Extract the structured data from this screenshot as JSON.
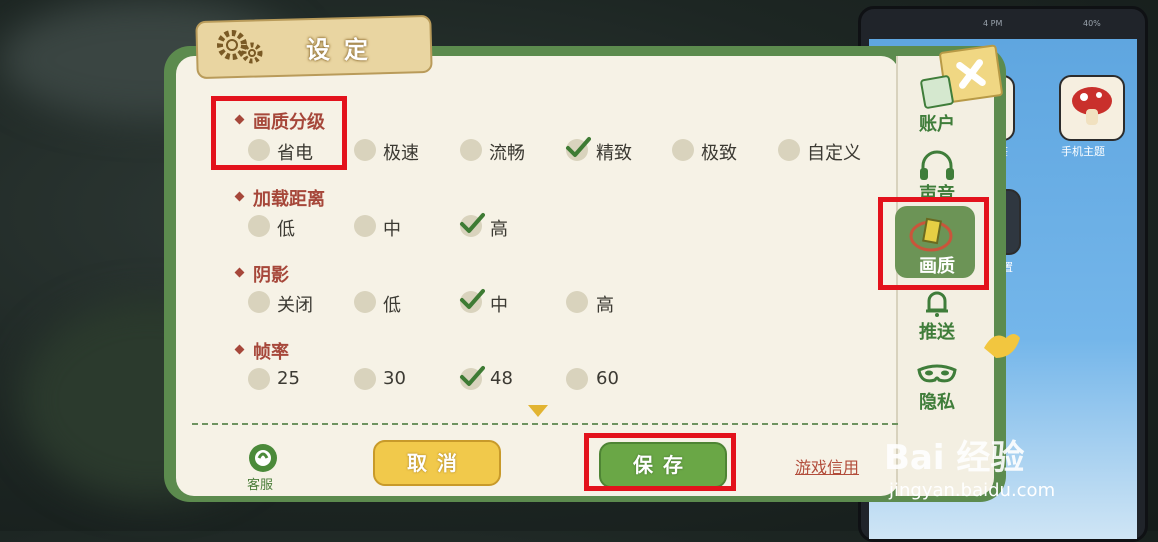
{
  "dialog": {
    "title": "设定"
  },
  "sections": [
    {
      "title": "画质分级",
      "options": [
        {
          "label": "省电",
          "selected": false
        },
        {
          "label": "极速",
          "selected": false
        },
        {
          "label": "流畅",
          "selected": false
        },
        {
          "label": "精致",
          "selected": true
        },
        {
          "label": "极致",
          "selected": false
        },
        {
          "label": "自定义",
          "selected": false
        }
      ]
    },
    {
      "title": "加载距离",
      "options": [
        {
          "label": "低",
          "selected": false
        },
        {
          "label": "中",
          "selected": false
        },
        {
          "label": "高",
          "selected": true
        }
      ]
    },
    {
      "title": "阴影",
      "options": [
        {
          "label": "关闭",
          "selected": false
        },
        {
          "label": "低",
          "selected": false
        },
        {
          "label": "中",
          "selected": true
        },
        {
          "label": "高",
          "selected": false
        }
      ]
    },
    {
      "title": "帧率",
      "options": [
        {
          "label": "25",
          "selected": false
        },
        {
          "label": "30",
          "selected": false
        },
        {
          "label": "48",
          "selected": true
        },
        {
          "label": "60",
          "selected": false
        }
      ]
    }
  ],
  "footer": {
    "customer_service": "客服",
    "cancel": "取消",
    "save": "保存",
    "credit_link": "游戏信用"
  },
  "sidebar": {
    "items": [
      {
        "label": "账户",
        "icon": "account-icon"
      },
      {
        "label": "声音",
        "icon": "headphones-icon"
      },
      {
        "label": "画质",
        "icon": "graphics-icon",
        "active": true
      },
      {
        "label": "推送",
        "icon": "bell-icon"
      },
      {
        "label": "隐私",
        "icon": "mask-icon"
      }
    ]
  },
  "background_phone": {
    "status_time": "4 PM",
    "battery": "40%",
    "apps": [
      {
        "label": "鉴"
      },
      {
        "label": "手机主题"
      },
      {
        "label": "置"
      }
    ]
  },
  "watermark": {
    "brand": "Bai 经验",
    "url": "jingyan.baidu.com"
  },
  "colors": {
    "panel_green": "#5c8b4e",
    "paper": "#f6f2e6",
    "section_title": "#a6473a",
    "cancel_yellow": "#f1c94b",
    "save_green": "#6aa746",
    "highlight_red": "#e3121c"
  }
}
